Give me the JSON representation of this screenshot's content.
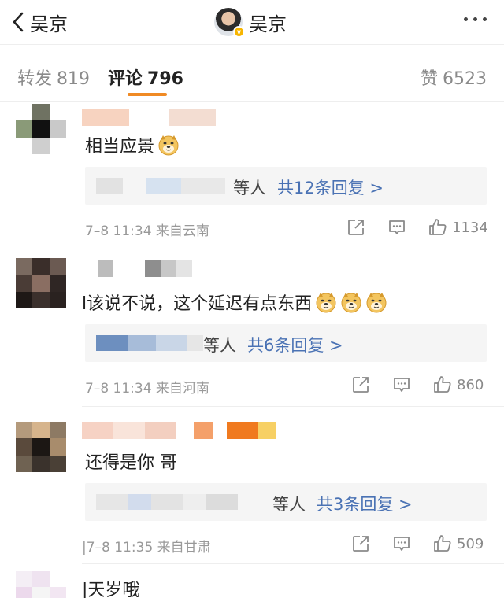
{
  "header": {
    "back_label": "吴京",
    "title": "吴京"
  },
  "tabs": {
    "forward": {
      "label": "转发",
      "count": "819"
    },
    "comments": {
      "label": "评论",
      "count": "796"
    },
    "likes": {
      "label": "赞",
      "count": "6523"
    }
  },
  "comments": [
    {
      "text": "相当应景",
      "emoji": "doge",
      "reply": {
        "who": "等人",
        "count_text": "共12条回复 >"
      },
      "meta": "7–8 11:34 来自云南",
      "likes": "1134"
    },
    {
      "text": "l该说不说，这个延迟有点东西",
      "emoji": "doge",
      "reply": {
        "who": "等人",
        "count_text": "共6条回复 >"
      },
      "meta": "7–8 11:34 来自河南",
      "likes": "860"
    },
    {
      "text": "还得是你 哥",
      "emoji": "",
      "reply": {
        "who": "等人",
        "count_text": "共3条回复 >"
      },
      "meta": "|7–8 11:35 来自甘肃",
      "likes": "509"
    },
    {
      "text": "|天岁哦"
    }
  ],
  "icons": {
    "back": "chevron-left-icon",
    "verified": "verified-badge-icon",
    "more": "more-dots-icon",
    "share": "share-icon",
    "reply": "comment-icon",
    "like": "thumbs-up-icon",
    "doge": "doge-emoji-icon"
  },
  "colors": {
    "accent_underline": "#f08a24",
    "reply_link": "#4a72b4",
    "meta_gray": "#999999",
    "reply_bg": "#f5f5f5"
  }
}
